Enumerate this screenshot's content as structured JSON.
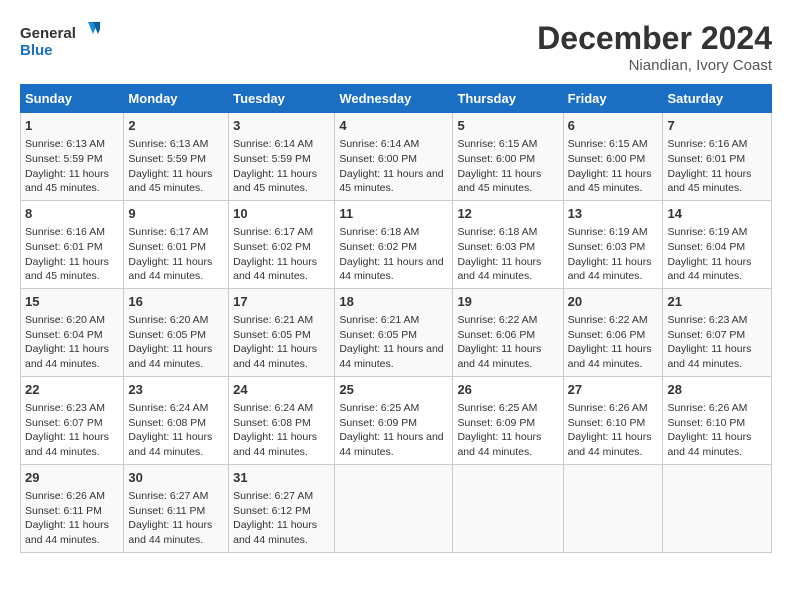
{
  "logo": {
    "text_general": "General",
    "text_blue": "Blue"
  },
  "title": "December 2024",
  "subtitle": "Niandian, Ivory Coast",
  "header_days": [
    "Sunday",
    "Monday",
    "Tuesday",
    "Wednesday",
    "Thursday",
    "Friday",
    "Saturday"
  ],
  "weeks": [
    [
      {
        "day": "1",
        "sunrise": "6:13 AM",
        "sunset": "5:59 PM",
        "daylight": "11 hours and 45 minutes."
      },
      {
        "day": "2",
        "sunrise": "6:13 AM",
        "sunset": "5:59 PM",
        "daylight": "11 hours and 45 minutes."
      },
      {
        "day": "3",
        "sunrise": "6:14 AM",
        "sunset": "5:59 PM",
        "daylight": "11 hours and 45 minutes."
      },
      {
        "day": "4",
        "sunrise": "6:14 AM",
        "sunset": "6:00 PM",
        "daylight": "11 hours and 45 minutes."
      },
      {
        "day": "5",
        "sunrise": "6:15 AM",
        "sunset": "6:00 PM",
        "daylight": "11 hours and 45 minutes."
      },
      {
        "day": "6",
        "sunrise": "6:15 AM",
        "sunset": "6:00 PM",
        "daylight": "11 hours and 45 minutes."
      },
      {
        "day": "7",
        "sunrise": "6:16 AM",
        "sunset": "6:01 PM",
        "daylight": "11 hours and 45 minutes."
      }
    ],
    [
      {
        "day": "8",
        "sunrise": "6:16 AM",
        "sunset": "6:01 PM",
        "daylight": "11 hours and 45 minutes."
      },
      {
        "day": "9",
        "sunrise": "6:17 AM",
        "sunset": "6:01 PM",
        "daylight": "11 hours and 44 minutes."
      },
      {
        "day": "10",
        "sunrise": "6:17 AM",
        "sunset": "6:02 PM",
        "daylight": "11 hours and 44 minutes."
      },
      {
        "day": "11",
        "sunrise": "6:18 AM",
        "sunset": "6:02 PM",
        "daylight": "11 hours and 44 minutes."
      },
      {
        "day": "12",
        "sunrise": "6:18 AM",
        "sunset": "6:03 PM",
        "daylight": "11 hours and 44 minutes."
      },
      {
        "day": "13",
        "sunrise": "6:19 AM",
        "sunset": "6:03 PM",
        "daylight": "11 hours and 44 minutes."
      },
      {
        "day": "14",
        "sunrise": "6:19 AM",
        "sunset": "6:04 PM",
        "daylight": "11 hours and 44 minutes."
      }
    ],
    [
      {
        "day": "15",
        "sunrise": "6:20 AM",
        "sunset": "6:04 PM",
        "daylight": "11 hours and 44 minutes."
      },
      {
        "day": "16",
        "sunrise": "6:20 AM",
        "sunset": "6:05 PM",
        "daylight": "11 hours and 44 minutes."
      },
      {
        "day": "17",
        "sunrise": "6:21 AM",
        "sunset": "6:05 PM",
        "daylight": "11 hours and 44 minutes."
      },
      {
        "day": "18",
        "sunrise": "6:21 AM",
        "sunset": "6:05 PM",
        "daylight": "11 hours and 44 minutes."
      },
      {
        "day": "19",
        "sunrise": "6:22 AM",
        "sunset": "6:06 PM",
        "daylight": "11 hours and 44 minutes."
      },
      {
        "day": "20",
        "sunrise": "6:22 AM",
        "sunset": "6:06 PM",
        "daylight": "11 hours and 44 minutes."
      },
      {
        "day": "21",
        "sunrise": "6:23 AM",
        "sunset": "6:07 PM",
        "daylight": "11 hours and 44 minutes."
      }
    ],
    [
      {
        "day": "22",
        "sunrise": "6:23 AM",
        "sunset": "6:07 PM",
        "daylight": "11 hours and 44 minutes."
      },
      {
        "day": "23",
        "sunrise": "6:24 AM",
        "sunset": "6:08 PM",
        "daylight": "11 hours and 44 minutes."
      },
      {
        "day": "24",
        "sunrise": "6:24 AM",
        "sunset": "6:08 PM",
        "daylight": "11 hours and 44 minutes."
      },
      {
        "day": "25",
        "sunrise": "6:25 AM",
        "sunset": "6:09 PM",
        "daylight": "11 hours and 44 minutes."
      },
      {
        "day": "26",
        "sunrise": "6:25 AM",
        "sunset": "6:09 PM",
        "daylight": "11 hours and 44 minutes."
      },
      {
        "day": "27",
        "sunrise": "6:26 AM",
        "sunset": "6:10 PM",
        "daylight": "11 hours and 44 minutes."
      },
      {
        "day": "28",
        "sunrise": "6:26 AM",
        "sunset": "6:10 PM",
        "daylight": "11 hours and 44 minutes."
      }
    ],
    [
      {
        "day": "29",
        "sunrise": "6:26 AM",
        "sunset": "6:11 PM",
        "daylight": "11 hours and 44 minutes."
      },
      {
        "day": "30",
        "sunrise": "6:27 AM",
        "sunset": "6:11 PM",
        "daylight": "11 hours and 44 minutes."
      },
      {
        "day": "31",
        "sunrise": "6:27 AM",
        "sunset": "6:12 PM",
        "daylight": "11 hours and 44 minutes."
      },
      null,
      null,
      null,
      null
    ]
  ],
  "labels": {
    "sunrise": "Sunrise:",
    "sunset": "Sunset:",
    "daylight": "Daylight:"
  }
}
